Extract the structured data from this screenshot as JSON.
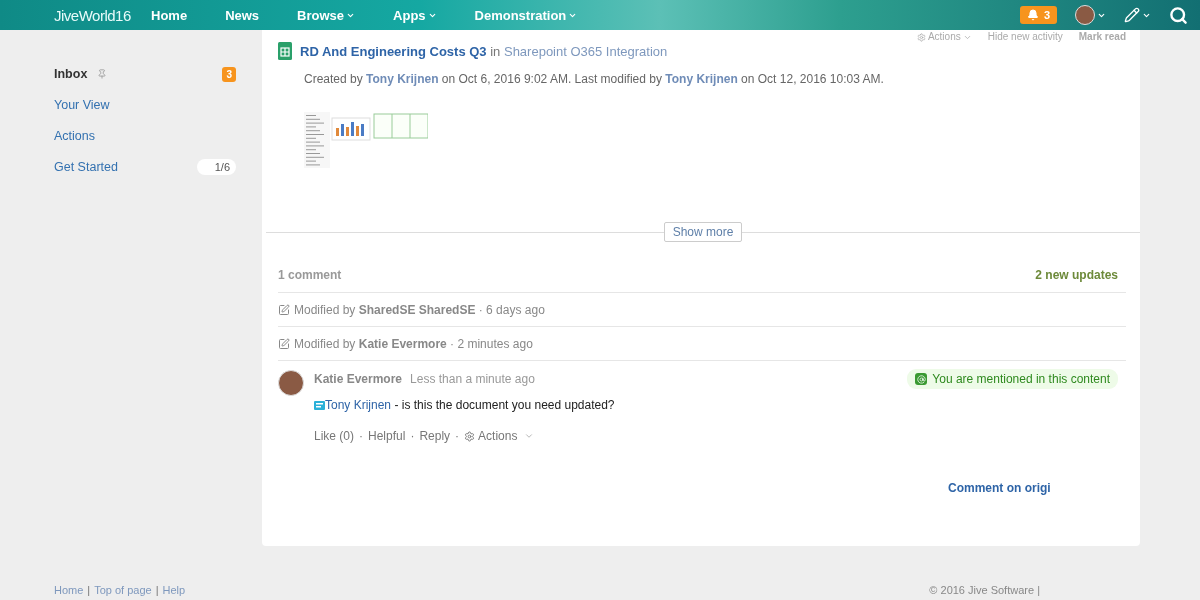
{
  "header": {
    "logo": "JiveWorld",
    "logo_number": "16",
    "nav": [
      {
        "label": "Home",
        "dropdown": false
      },
      {
        "label": "News",
        "dropdown": false
      },
      {
        "label": "Browse",
        "dropdown": true
      },
      {
        "label": "Apps",
        "dropdown": true
      },
      {
        "label": "Demonstration",
        "dropdown": true
      }
    ],
    "notifications": "3"
  },
  "sidebar": {
    "items": [
      {
        "label": "Inbox",
        "kind": "title",
        "badge": "3"
      },
      {
        "label": "Your View",
        "kind": "link"
      },
      {
        "label": "Actions",
        "kind": "link"
      },
      {
        "label": "Get Started",
        "kind": "link",
        "progress": "1/6"
      }
    ]
  },
  "activity": {
    "toolbar": [
      {
        "label": "Actions",
        "kind": "menu"
      },
      {
        "label": "Hide new activity",
        "kind": "link"
      },
      {
        "label": "Mark read",
        "kind": "strong"
      }
    ],
    "title": "RD And Engineering Costs Q3",
    "in_text": "in",
    "place": "Sharepoint O365 Integration",
    "meta": [
      {
        "kind": "text",
        "text": "Created by "
      },
      {
        "kind": "link",
        "text": "Tony Krijnen"
      },
      {
        "kind": "text",
        "text": " on Oct 6, 2016 9:02 AM. Last modified by "
      },
      {
        "kind": "link",
        "text": "Tony Krijnen"
      },
      {
        "kind": "text",
        "text": " on Oct 12, 2016 10:03 AM."
      }
    ],
    "show_more": "Show more",
    "comment_count": "1 comment",
    "new_updates": "2 new updates",
    "updates": [
      {
        "prefix": "Modified by",
        "user": "SharedSE SharedSE",
        "time": "· 6 days ago"
      },
      {
        "prefix": "Modified by",
        "user": "Katie Evermore",
        "time": "· 2 minutes ago"
      }
    ],
    "comment": {
      "author": "Katie Evermore",
      "time": "Less than a minute ago",
      "mention_badge": "You are mentioned in this content",
      "mention": "Tony Krijnen",
      "body": " - is this the document you need updated?",
      "separator": "·",
      "actions": [
        {
          "label": "Like (0)",
          "kind": "link"
        },
        {
          "label": "Helpful",
          "kind": "link"
        },
        {
          "label": "Reply",
          "kind": "link"
        },
        {
          "label": "Actions",
          "kind": "menu"
        }
      ]
    },
    "comment_link": "Comment on origi"
  },
  "footer": {
    "separator": "|",
    "links": [
      "Home",
      "Top of page",
      "Help"
    ],
    "copyright": "© 2016 Jive Software |"
  }
}
